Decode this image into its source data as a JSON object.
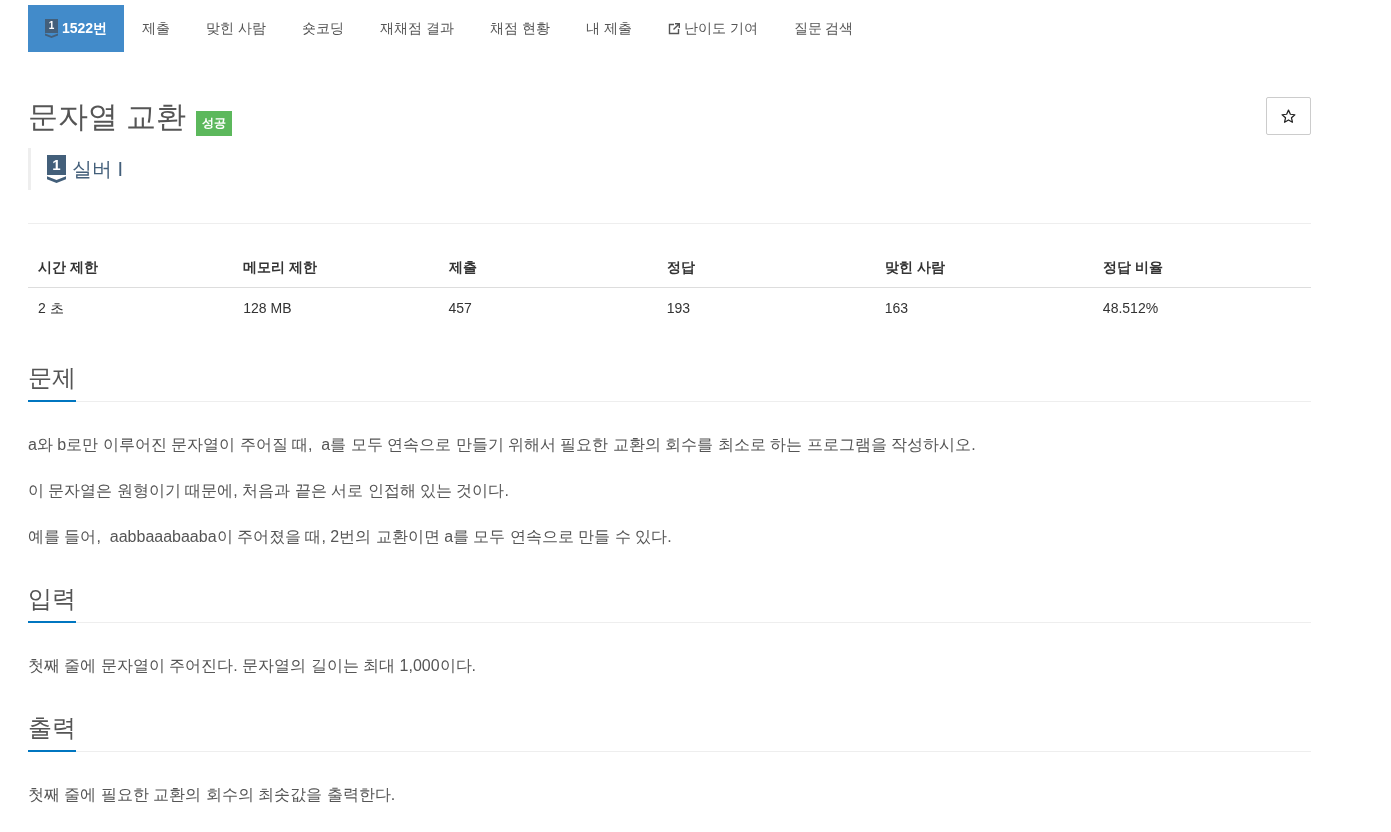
{
  "nav": {
    "tabs": [
      {
        "kind": "problem",
        "tier_number": "1",
        "label": "1522번",
        "selected": true
      },
      {
        "kind": "plain",
        "label": "제출",
        "selected": false
      },
      {
        "kind": "plain",
        "label": "맞힌 사람",
        "selected": false
      },
      {
        "kind": "plain",
        "label": "숏코딩",
        "selected": false
      },
      {
        "kind": "plain",
        "label": "재채점 결과",
        "selected": false
      },
      {
        "kind": "plain",
        "label": "채점 현황",
        "selected": false
      },
      {
        "kind": "plain",
        "label": "내 제출",
        "selected": false
      },
      {
        "kind": "external",
        "label": "난이도 기여",
        "selected": false
      },
      {
        "kind": "plain",
        "label": "질문 검색",
        "selected": false
      }
    ]
  },
  "problem": {
    "title": "문자열 교환",
    "result_badge": "성공",
    "tier": {
      "number": "1",
      "name": "실버 I"
    }
  },
  "limits_table": {
    "columns": [
      "시간 제한",
      "메모리 제한",
      "제출",
      "정답",
      "맞힌 사람",
      "정답 비율"
    ],
    "rows": [
      [
        "2 초",
        "128 MB",
        "457",
        "193",
        "163",
        "48.512%"
      ]
    ]
  },
  "sections": [
    {
      "heading": "문제",
      "paragraphs": [
        "a와 b로만 이루어진 문자열이 주어질 때,  a를 모두 연속으로 만들기 위해서 필요한 교환의 회수를 최소로 하는 프로그램을 작성하시오.",
        "이 문자열은 원형이기 때문에, 처음과 끝은 서로 인접해 있는 것이다.",
        "예를 들어,  aabbaaabaaba이 주어졌을 때, 2번의 교환이면 a를 모두 연속으로 만들 수 있다."
      ]
    },
    {
      "heading": "입력",
      "paragraphs": [
        "첫째 줄에 문자열이 주어진다. 문자열의 길이는 최대 1,000이다."
      ]
    },
    {
      "heading": "출력",
      "paragraphs": [
        "첫째 줄에 필요한 교환의 회수의 최솟값을 출력한다."
      ]
    }
  ]
}
